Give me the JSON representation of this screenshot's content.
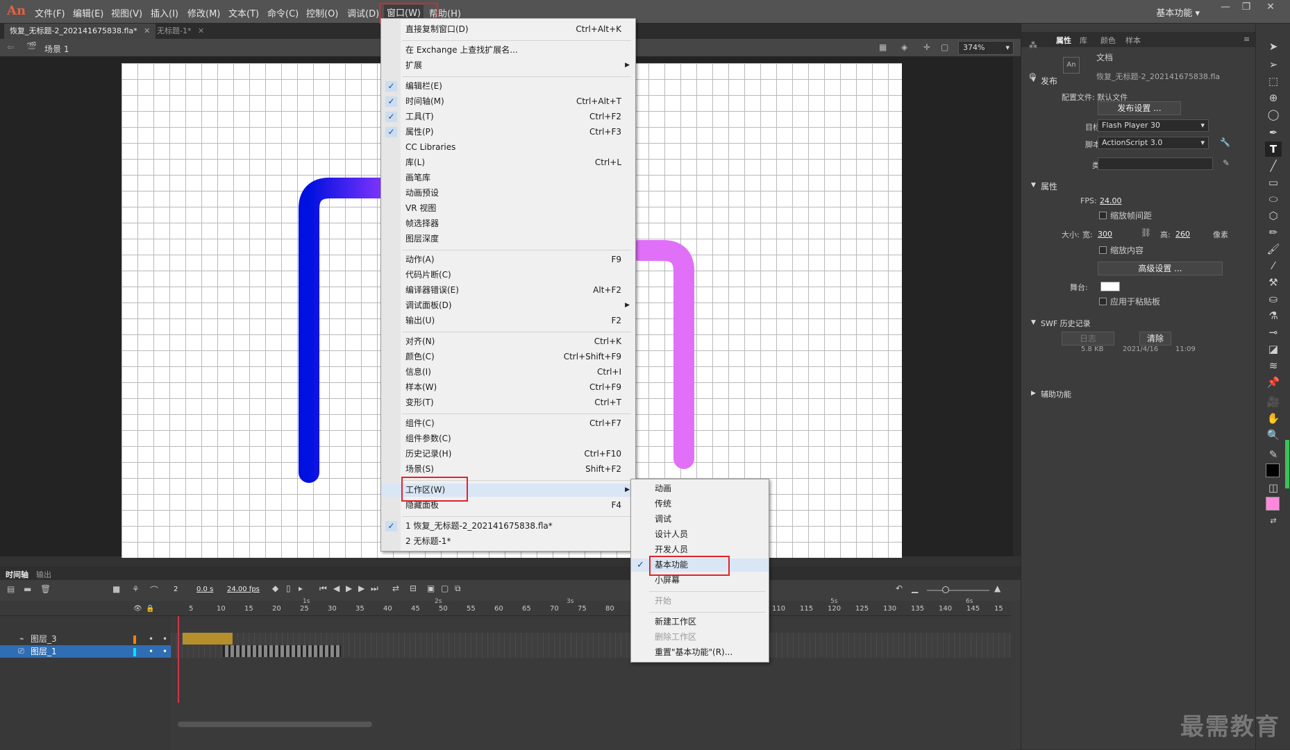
{
  "app": {
    "logo": "An"
  },
  "menubar": {
    "items": [
      "文件(F)",
      "编辑(E)",
      "视图(V)",
      "插入(I)",
      "修改(M)",
      "文本(T)",
      "命令(C)",
      "控制(O)",
      "调试(D)",
      "窗口(W)",
      "帮助(H)"
    ],
    "workspace": "基本功能"
  },
  "tabs": [
    "恢复_无标题-2_202141675838.fla*",
    "无标题-1*"
  ],
  "scene": {
    "label": "场景 1",
    "zoom": "374%"
  },
  "window_menu": {
    "items": [
      {
        "label": "直接复制窗口(D)",
        "shortcut": "Ctrl+Alt+K"
      },
      {
        "label": "在 Exchange 上查找扩展名..."
      },
      {
        "label": "扩展",
        "submenu": true
      },
      {
        "label": "编辑栏(E)",
        "checked": true
      },
      {
        "label": "时间轴(M)",
        "shortcut": "Ctrl+Alt+T",
        "checked": true
      },
      {
        "label": "工具(T)",
        "shortcut": "Ctrl+F2",
        "checked": true
      },
      {
        "label": "属性(P)",
        "shortcut": "Ctrl+F3",
        "checked": true
      },
      {
        "label": "CC Libraries"
      },
      {
        "label": "库(L)",
        "shortcut": "Ctrl+L"
      },
      {
        "label": "画笔库"
      },
      {
        "label": "动画预设"
      },
      {
        "label": "VR 视图"
      },
      {
        "label": "帧选择器"
      },
      {
        "label": "图层深度"
      },
      {
        "label": "动作(A)",
        "shortcut": "F9"
      },
      {
        "label": "代码片断(C)"
      },
      {
        "label": "编译器错误(E)",
        "shortcut": "Alt+F2"
      },
      {
        "label": "调试面板(D)",
        "submenu": true
      },
      {
        "label": "输出(U)",
        "shortcut": "F2"
      },
      {
        "label": "对齐(N)",
        "shortcut": "Ctrl+K"
      },
      {
        "label": "颜色(C)",
        "shortcut": "Ctrl+Shift+F9"
      },
      {
        "label": "信息(I)",
        "shortcut": "Ctrl+I"
      },
      {
        "label": "样本(W)",
        "shortcut": "Ctrl+F9"
      },
      {
        "label": "变形(T)",
        "shortcut": "Ctrl+T"
      },
      {
        "label": "组件(C)",
        "shortcut": "Ctrl+F7"
      },
      {
        "label": "组件参数(C)"
      },
      {
        "label": "历史记录(H)",
        "shortcut": "Ctrl+F10"
      },
      {
        "label": "场景(S)",
        "shortcut": "Shift+F2"
      },
      {
        "label": "工作区(W)",
        "submenu": true
      },
      {
        "label": "隐藏面板",
        "shortcut": "F4"
      },
      {
        "label": "1 恢复_无标题-2_202141675838.fla*",
        "checked": true
      },
      {
        "label": "2 无标题-1*"
      }
    ]
  },
  "workspace_menu": {
    "items": [
      {
        "label": "动画"
      },
      {
        "label": "传统"
      },
      {
        "label": "调试"
      },
      {
        "label": "设计人员"
      },
      {
        "label": "开发人员"
      },
      {
        "label": "基本功能",
        "checked": true
      },
      {
        "label": "小屏幕"
      },
      {
        "label": "开始",
        "disabled": true
      },
      {
        "label": "新建工作区"
      },
      {
        "label": "删除工作区",
        "disabled": true
      },
      {
        "label": "重置\"基本功能\"(R)..."
      }
    ]
  },
  "timeline": {
    "tabs": [
      "时间轴",
      "输出"
    ],
    "current_frame": "2",
    "time": "0.0 s",
    "fps": "24.00 fps",
    "ruler_numbers": [
      "5",
      "10",
      "15",
      "20",
      "25",
      "30",
      "35",
      "40",
      "45",
      "50",
      "55",
      "60",
      "65",
      "70",
      "75",
      "80",
      "110",
      "115",
      "120",
      "125",
      "130",
      "135",
      "140",
      "145",
      "15"
    ],
    "ruler_seconds": [
      "1s",
      "2s",
      "3s",
      "5s",
      "6s"
    ],
    "layers": [
      "图层_3",
      "图层_1"
    ],
    "layer_colors": [
      "#ff7f00",
      "#00e5ff"
    ]
  },
  "properties": {
    "tabs": [
      "属性",
      "库",
      "颜色",
      "样本"
    ],
    "doc_label": "文档",
    "file_name": "恢复_无标题-2_202141675838.fla",
    "publish": {
      "section": "发布",
      "profile": "配置文件: 默认文件",
      "settings_btn": "发布设置 ...",
      "target_label": "目标:",
      "target": "Flash Player 30",
      "script_label": "脚本:",
      "script": "ActionScript 3.0",
      "class_label": "类:"
    },
    "attrs": {
      "section": "属性",
      "fps_label": "FPS:",
      "fps": "24.00",
      "scale_spacing": "缩放帧间距",
      "size_label": "大小:",
      "width_label": "宽:",
      "width": "300",
      "height_label": "高:",
      "height": "260",
      "unit": "像素",
      "scale_content": "缩放内容",
      "advanced_btn": "高级设置 ...",
      "stage_label": "舞台:",
      "apply_paste": "应用于粘贴板"
    },
    "swf": {
      "section": "SWF 历史记录",
      "log_btn": "日志",
      "clear_btn": "清除",
      "size": "5.8 KB",
      "date": "2021/4/16",
      "time": "11:09"
    },
    "access": {
      "section": "辅助功能"
    }
  },
  "watermark": "最需教育",
  "colors": {
    "accent_red": "#e0232a",
    "stage_bg": "#ffffff",
    "fill_color": "#ff88dd"
  }
}
